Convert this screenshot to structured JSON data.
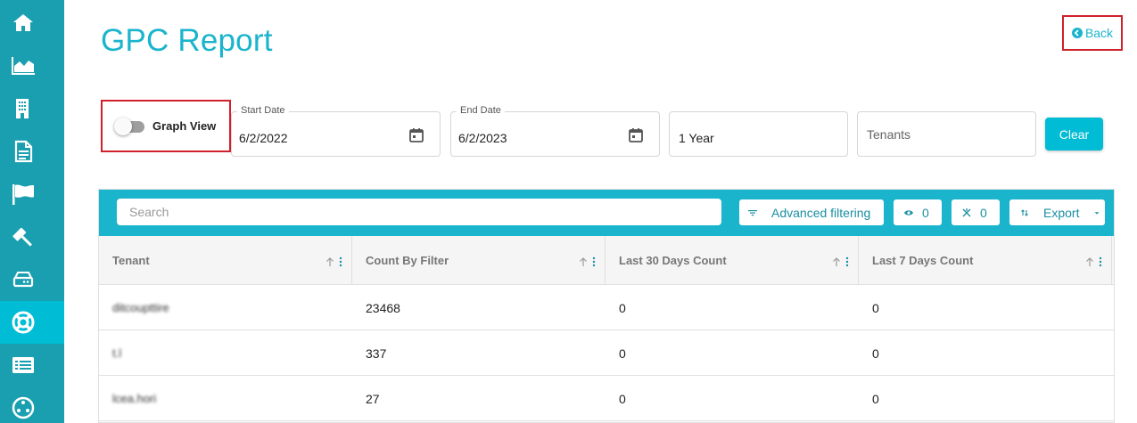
{
  "sidebar": {
    "items": [
      {
        "icon": "home-icon"
      },
      {
        "icon": "area-chart-icon"
      },
      {
        "icon": "building-icon"
      },
      {
        "icon": "document-icon"
      },
      {
        "icon": "flag-icon"
      },
      {
        "icon": "gavel-icon"
      },
      {
        "icon": "drive-icon"
      },
      {
        "icon": "lifebuoy-icon",
        "active": true
      },
      {
        "icon": "list-icon"
      },
      {
        "icon": "network-icon"
      }
    ],
    "colors": {
      "background": "#1a9fb1",
      "active": "#00bcd4"
    }
  },
  "page": {
    "title": "GPC Report",
    "back_label": "Back"
  },
  "filters": {
    "graph_view_label": "Graph View",
    "graph_view_on": false,
    "start_date": {
      "label": "Start Date",
      "value": "6/2/2022"
    },
    "end_date": {
      "label": "End Date",
      "value": "6/2/2023"
    },
    "period": {
      "value": "1 Year"
    },
    "tenants": {
      "placeholder": "Tenants"
    },
    "clear_label": "Clear"
  },
  "grid": {
    "search_placeholder": "Search",
    "advanced_filtering_label": "Advanced filtering",
    "visible_count": "0",
    "hidden_count": "0",
    "export_label": "Export",
    "columns": [
      "Tenant",
      "Count By Filter",
      "Last 30 Days Count",
      "Last 7 Days Count"
    ],
    "rows": [
      {
        "tenant": "ditcoupttire",
        "count_by_filter": "23468",
        "last_30": "0",
        "last_7": "0"
      },
      {
        "tenant": "t.l",
        "count_by_filter": "337",
        "last_30": "0",
        "last_7": "0"
      },
      {
        "tenant": "lcea.hori",
        "count_by_filter": "27",
        "last_30": "0",
        "last_7": "0"
      }
    ]
  },
  "colors": {
    "accent": "#1ab4cc",
    "highlight_border": "#d0202a"
  }
}
